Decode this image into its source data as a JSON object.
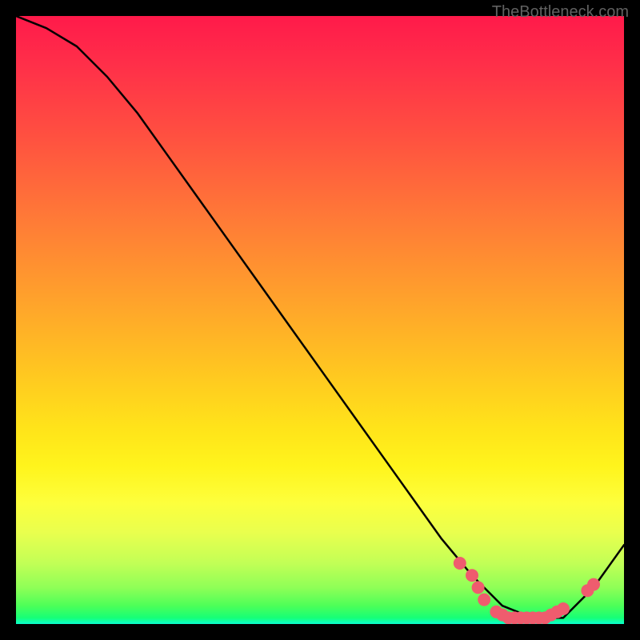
{
  "watermark": "TheBottleneck.com",
  "chart_data": {
    "type": "line",
    "title": "",
    "xlabel": "",
    "ylabel": "",
    "xlim": [
      0,
      100
    ],
    "ylim": [
      0,
      100
    ],
    "grid": false,
    "legend": null,
    "series": [
      {
        "name": "curve",
        "color": "#000000",
        "x": [
          0,
          5,
          10,
          15,
          20,
          25,
          30,
          35,
          40,
          45,
          50,
          55,
          60,
          65,
          70,
          75,
          80,
          85,
          90,
          95,
          100
        ],
        "values": [
          100,
          98,
          95,
          90,
          84,
          77,
          70,
          63,
          56,
          49,
          42,
          35,
          28,
          21,
          14,
          8,
          3,
          1,
          1,
          6,
          13
        ]
      }
    ],
    "markers": {
      "name": "dots",
      "color": "#ef5c6e",
      "radius": 8,
      "points": [
        {
          "x": 73,
          "y": 10
        },
        {
          "x": 75,
          "y": 8
        },
        {
          "x": 76,
          "y": 6
        },
        {
          "x": 77,
          "y": 4
        },
        {
          "x": 79,
          "y": 2
        },
        {
          "x": 80,
          "y": 1.5
        },
        {
          "x": 81,
          "y": 1
        },
        {
          "x": 82,
          "y": 1
        },
        {
          "x": 83,
          "y": 1
        },
        {
          "x": 84,
          "y": 1
        },
        {
          "x": 85,
          "y": 1
        },
        {
          "x": 86,
          "y": 1
        },
        {
          "x": 87,
          "y": 1
        },
        {
          "x": 88,
          "y": 1.5
        },
        {
          "x": 89,
          "y": 2
        },
        {
          "x": 90,
          "y": 2.5
        },
        {
          "x": 94,
          "y": 5.5
        },
        {
          "x": 95,
          "y": 6.5
        }
      ]
    },
    "background_gradient": {
      "top": "#ff1a4a",
      "mid": "#ffe41a",
      "bottom": "#0affce"
    }
  }
}
